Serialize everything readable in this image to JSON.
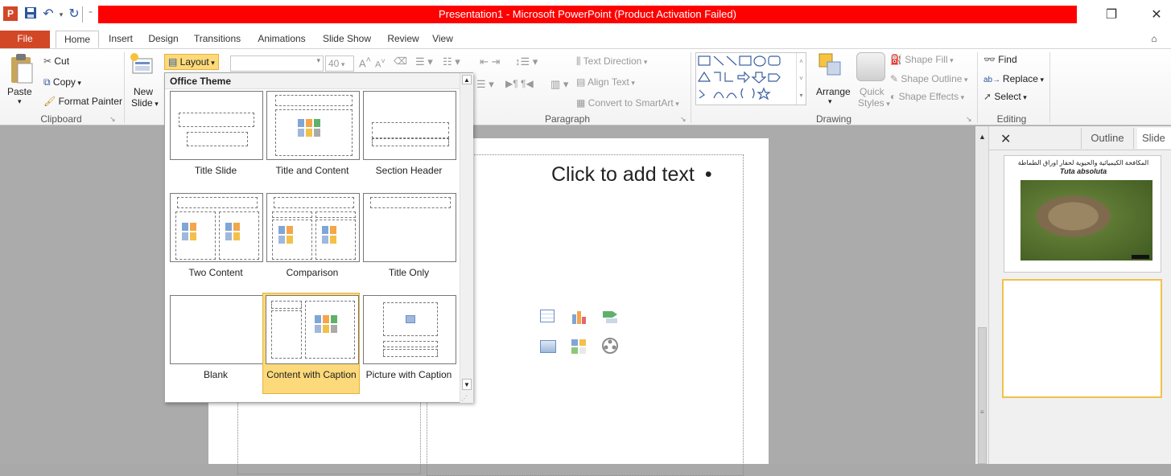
{
  "window": {
    "title": "Presentation1  -  Microsoft PowerPoint (Product Activation Failed)",
    "app_icon": "P"
  },
  "tabs": [
    "File",
    "Home",
    "Insert",
    "Design",
    "Transitions",
    "Animations",
    "Slide Show",
    "Review",
    "View"
  ],
  "ribbon": {
    "clipboard": {
      "paste": "Paste",
      "cut": "Cut",
      "copy": "Copy",
      "format_painter": "Format Painter",
      "label": "Clipboard"
    },
    "slides": {
      "new_slide_line1": "New",
      "new_slide_line2": "Slide",
      "layout": "Layout"
    },
    "font": {
      "size": "40"
    },
    "paragraph": {
      "text_direction": "Text Direction",
      "align_text": "Align Text",
      "convert_smartart": "Convert to SmartArt",
      "label": "Paragraph"
    },
    "drawing": {
      "arrange": "Arrange",
      "quick": "Quick",
      "styles": "Styles",
      "shape_fill": "Shape Fill",
      "shape_outline": "Shape Outline",
      "shape_effects": "Shape Effects",
      "label": "Drawing"
    },
    "editing": {
      "find": "Find",
      "replace": "Replace",
      "select": "Select",
      "label": "Editing"
    }
  },
  "gallery": {
    "header": "Office Theme",
    "layouts": [
      {
        "label": "Title Slide"
      },
      {
        "label": "Title and Content"
      },
      {
        "label": "Section Header"
      },
      {
        "label": "Two Content"
      },
      {
        "label": "Comparison"
      },
      {
        "label": "Title Only"
      },
      {
        "label": "Blank"
      },
      {
        "label": "Content with Caption",
        "selected": true
      },
      {
        "label": "Picture with Caption"
      }
    ]
  },
  "slide": {
    "body_placeholder": "Click to add text",
    "bullet": "•"
  },
  "pane": {
    "close": "✕",
    "tab_outline": "Outline",
    "tab_slides": "Slide",
    "thumb1_title_ar": "المكافحة الكيميائية والحيوية لحفار اوراق الطماطة",
    "thumb1_title_en": "Tuta absoluta"
  },
  "colors": {
    "title_band": "#ff0000",
    "file_tab": "#d24726",
    "selected_layout": "#fcd97a",
    "selected_border": "#e3b23c",
    "workspace": "#ababab"
  }
}
